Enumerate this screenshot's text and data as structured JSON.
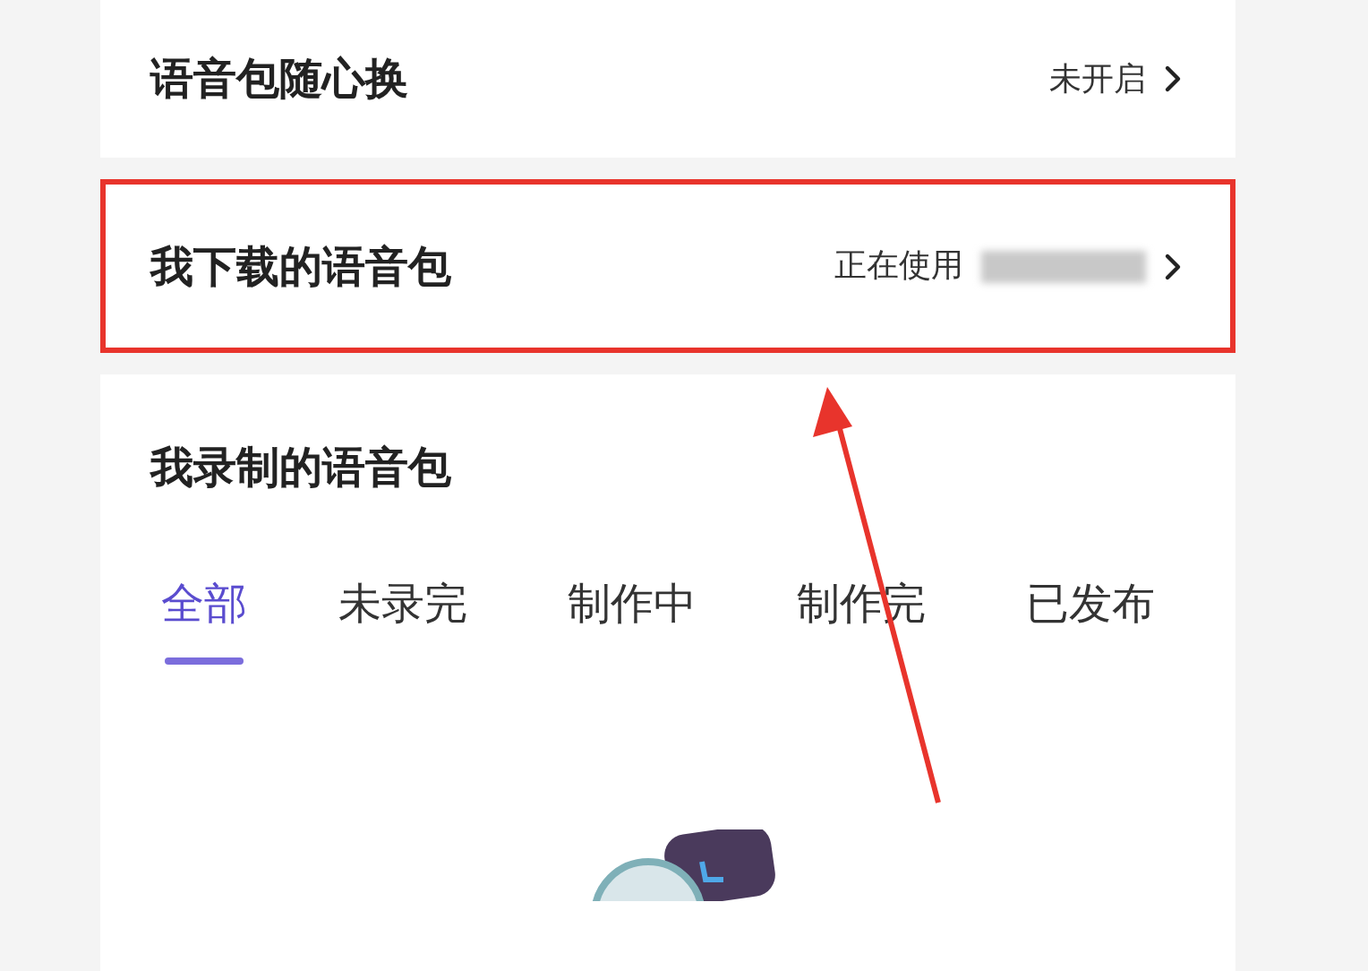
{
  "settings_rows": [
    {
      "label": "语音包随心换",
      "value": "未开启",
      "redacted": false,
      "highlighted": false
    },
    {
      "label": "我下载的语音包",
      "value": "正在使用",
      "redacted": true,
      "highlighted": true
    }
  ],
  "recorded_section": {
    "title": "我录制的语音包",
    "tabs": [
      {
        "label": "全部",
        "selected": true
      },
      {
        "label": "未录完",
        "selected": false
      },
      {
        "label": "制作中",
        "selected": false
      },
      {
        "label": "制作完",
        "selected": false
      },
      {
        "label": "已发布",
        "selected": false
      }
    ]
  }
}
